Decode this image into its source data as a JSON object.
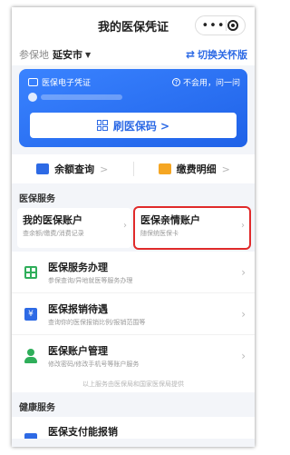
{
  "header": {
    "title": "我的医保凭证"
  },
  "location": {
    "label": "参保地",
    "city": "延安市",
    "care_mode": "切换关怀版"
  },
  "card": {
    "brand": "医保电子凭证",
    "not_use": "不会用，问一问",
    "scan_button": "刷医保码 >"
  },
  "quick": [
    {
      "label": "余额查询",
      "chev": ">",
      "color": "#2d6ae5"
    },
    {
      "label": "缴费明细",
      "chev": ">",
      "color": "#f5a623"
    }
  ],
  "services": {
    "title": "医保服务",
    "accounts": [
      {
        "name": "我的医保账户",
        "desc": "查余额/缴费/消费记录"
      },
      {
        "name": "医保亲情账户",
        "desc": "随保统医保卡"
      }
    ],
    "rows": [
      {
        "title": "医保服务办理",
        "sub": "参保查询/异地就医等服务办理"
      },
      {
        "title": "医保报销待遇",
        "sub": "查询你的医保报销比例/报销范围等"
      },
      {
        "title": "医保账户管理",
        "sub": "修改密码/修改手机号等账户服务"
      }
    ],
    "footnote": "以上服务由医保局和国家医保局提供"
  },
  "health": {
    "title": "健康服务",
    "rows": [
      {
        "title": "医保支付能报销"
      }
    ]
  },
  "colors": {
    "accent": "#2d6ae5",
    "highlight": "#e02a2a",
    "green": "#2fae5a"
  }
}
